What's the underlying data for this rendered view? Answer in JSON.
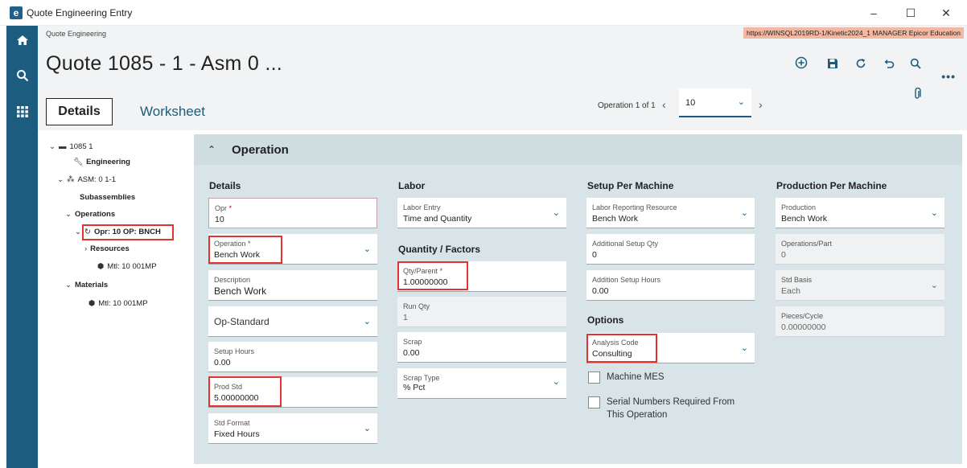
{
  "window": {
    "title": "Quote Engineering Entry",
    "minimize": "–",
    "maximize": "☐",
    "close": "✕"
  },
  "header": {
    "breadcrumb": "Quote Engineering",
    "environment": "https://WINSQL2019RD-1/Kinetic2024_1   MANAGER   Epicor Education",
    "title": "Quote 1085 - 1 - Asm 0 ...",
    "tabs": {
      "details": "Details",
      "worksheet": "Worksheet"
    },
    "nav": {
      "count": "Operation 1 of 1",
      "prev": "‹",
      "next": "›",
      "page_value": "10"
    },
    "more": "•••"
  },
  "tree": {
    "root": "1085 1",
    "engineering": "Engineering",
    "asm": "ASM: 0 1-1",
    "subassemblies": "Subassemblies",
    "operations": "Operations",
    "opr": "Opr: 10 OP: BNCH",
    "resources": "Resources",
    "resource_mtl": "Mtl: 10 001MP",
    "materials": "Materials",
    "material_mtl": "Mtl: 10 001MP"
  },
  "panel": {
    "title": "Operation"
  },
  "details": {
    "heading": "Details",
    "opr_label": "Opr",
    "opr_value": "10",
    "operation_label": "Operation",
    "operation_value": "Bench Work",
    "description_label": "Description",
    "description_value": "Bench Work",
    "op_standard": "Op-Standard",
    "setup_hours_label": "Setup Hours",
    "setup_hours_value": "0.00",
    "prod_std_label": "Prod Std",
    "prod_std_value": "5.00000000",
    "std_format_label": "Std Format",
    "std_format_value": "Fixed Hours"
  },
  "labor": {
    "heading": "Labor",
    "labor_entry_label": "Labor Entry",
    "labor_entry_value": "Time and Quantity",
    "qty_heading": "Quantity / Factors",
    "qty_parent_label": "Qty/Parent",
    "qty_parent_value": "1.00000000",
    "run_qty_label": "Run Qty",
    "run_qty_value": "1",
    "scrap_label": "Scrap",
    "scrap_value": "0.00",
    "scrap_type_label": "Scrap Type",
    "scrap_type_value": "% Pct"
  },
  "setup": {
    "heading": "Setup Per Machine",
    "resource_label": "Labor Reporting Resource",
    "resource_value": "Bench Work",
    "add_qty_label": "Additional Setup Qty",
    "add_qty_value": "0",
    "add_hours_label": "Addition Setup Hours",
    "add_hours_value": "0.00",
    "options_heading": "Options",
    "analysis_label": "Analysis Code",
    "analysis_value": "Consulting",
    "machine_mes": "Machine MES",
    "serial_line1": "Serial Numbers Required From",
    "serial_line2": "This Operation"
  },
  "production": {
    "heading": "Production Per Machine",
    "production_label": "Production",
    "production_value": "Bench Work",
    "ops_part_label": "Operations/Part",
    "ops_part_value": "0",
    "std_basis_label": "Std Basis",
    "std_basis_value": "Each",
    "pieces_label": "Pieces/Cycle",
    "pieces_value": "0.00000000"
  }
}
